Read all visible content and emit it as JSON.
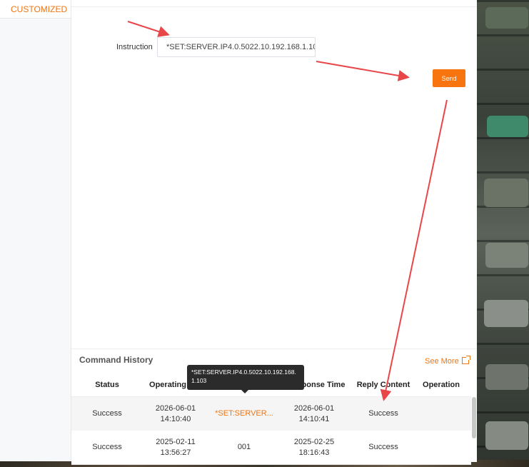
{
  "sidebar": {
    "items": [
      {
        "label": "CUSTOMIZED"
      }
    ]
  },
  "form": {
    "instruction_label": "Instruction",
    "instruction_value": "*SET:SERVER.IP4.0.5022.10.192.168.1.103",
    "send_label": "Send"
  },
  "history": {
    "title": "Command History",
    "see_more": "See More",
    "columns": [
      "Status",
      "Operating",
      "ponse Time",
      "Reply Content",
      "Operation"
    ],
    "rows": [
      {
        "status": "Success",
        "op_date": "2026-06-01",
        "op_time": "14:10:40",
        "instruction": "*SET:SERVER...",
        "resp_date": "2026-06-01",
        "resp_time": "14:10:41",
        "reply": "Success"
      },
      {
        "status": "Success",
        "op_date": "2025-02-11",
        "op_time": "13:56:27",
        "instruction": "001",
        "resp_date": "2025-02-25",
        "resp_time": "18:16:43",
        "reply": "Success"
      }
    ],
    "tooltip": "*SET:SERVER.IP4.0.5022.10.192.168.1.103"
  },
  "colors": {
    "accent": "#f7740f",
    "arrow": "#e8474a"
  }
}
